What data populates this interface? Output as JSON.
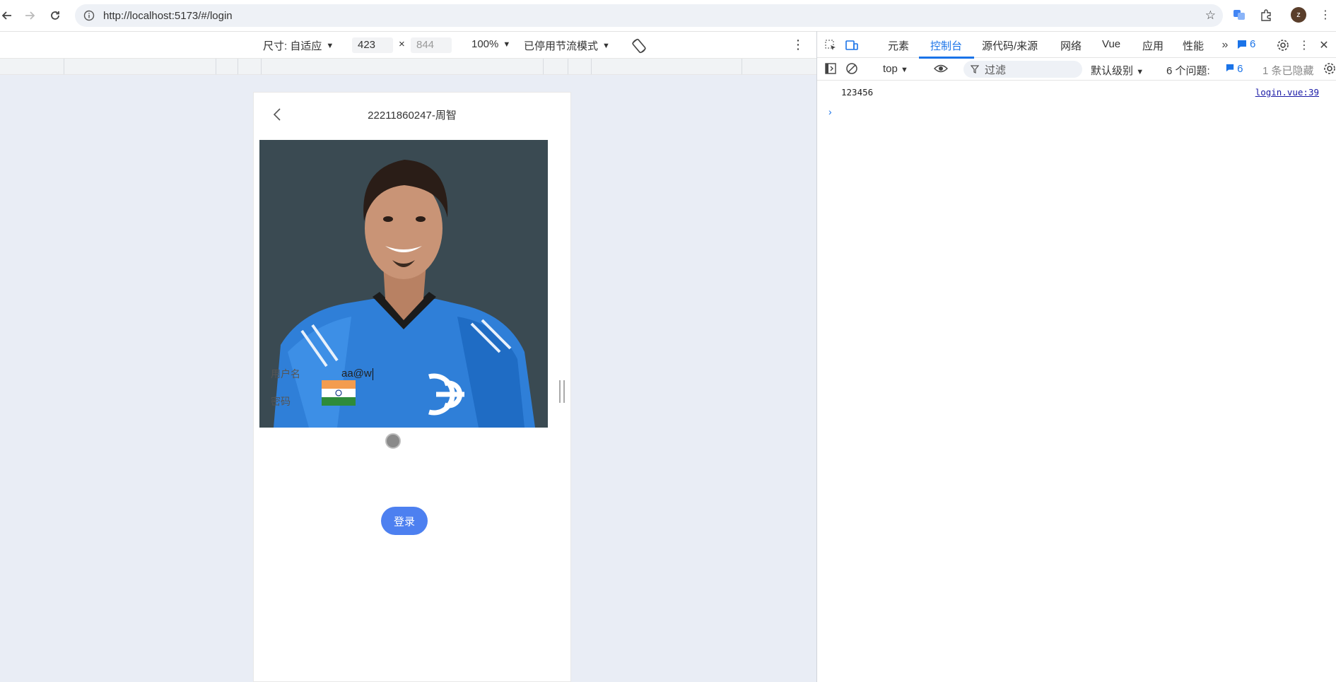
{
  "browser": {
    "url": "http://localhost:5173/#/login",
    "avatar_letter": "z"
  },
  "device_toolbar": {
    "size_label": "尺寸: 自适应",
    "width": "423",
    "times": "×",
    "height_placeholder": "844",
    "zoom": "100%",
    "throttle": "已停用节流模式"
  },
  "page": {
    "header_title": "22211860247-周智",
    "username_label": "用户名",
    "username_value": "aa@w",
    "password_label": "密码",
    "login_button": "登录"
  },
  "devtools": {
    "tabs": [
      "元素",
      "控制台",
      "源代码/来源",
      "网络",
      "Vue",
      "应用",
      "性能"
    ],
    "active_tab_index": 1,
    "issues_badge_count": "6",
    "context": "top",
    "filter_placeholder": "过滤",
    "log_level": "默认级别",
    "issues_label": "6 个问题:",
    "issues_count": "6",
    "hidden_label": "1 条已隐藏",
    "console": [
      {
        "message": "123456",
        "source": "login.vue:39"
      }
    ]
  },
  "colors": {
    "accent": "#1a73e8",
    "login_button": "#4d80f0",
    "viewport_bg": "#e9edf5",
    "photo_bg": "#3a4a52"
  }
}
